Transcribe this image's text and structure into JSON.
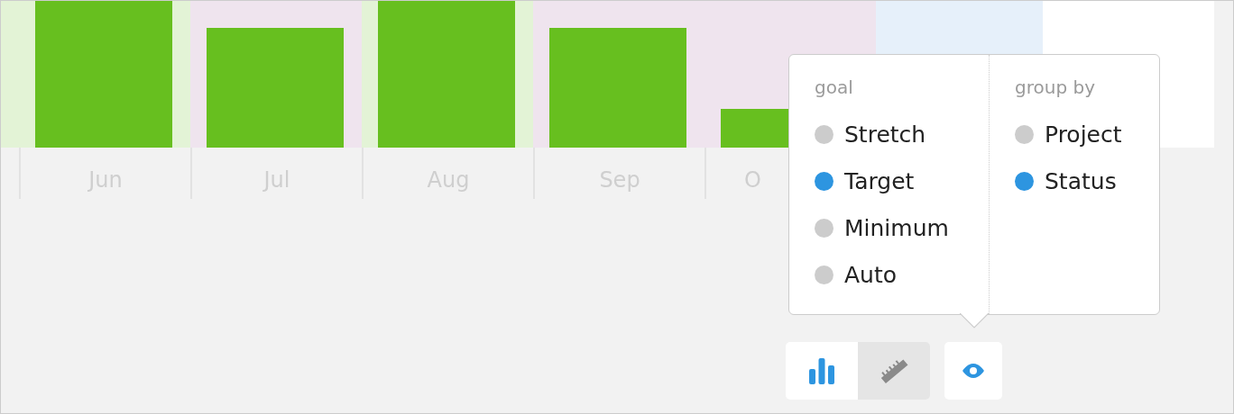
{
  "chart": {
    "months": [
      {
        "label": "Jun"
      },
      {
        "label": "Jul"
      },
      {
        "label": "Aug"
      },
      {
        "label": "Sep"
      },
      {
        "label": "O",
        "clipped": true
      }
    ]
  },
  "popup": {
    "columns": [
      {
        "heading": "goal",
        "options": [
          {
            "label": "Stretch",
            "selected": false
          },
          {
            "label": "Target",
            "selected": true
          },
          {
            "label": "Minimum",
            "selected": false
          },
          {
            "label": "Auto",
            "selected": false
          }
        ]
      },
      {
        "heading": "group by",
        "options": [
          {
            "label": "Project",
            "selected": false
          },
          {
            "label": "Status",
            "selected": true
          }
        ]
      }
    ]
  },
  "view_toggle": [
    {
      "kind": "chart",
      "selected": true
    },
    {
      "kind": "ruler",
      "selected": false
    }
  ]
}
